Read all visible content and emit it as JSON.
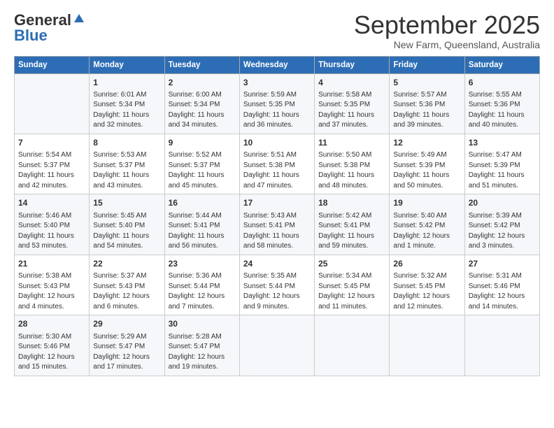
{
  "header": {
    "logo_general": "General",
    "logo_blue": "Blue",
    "month": "September 2025",
    "location": "New Farm, Queensland, Australia"
  },
  "days_of_week": [
    "Sunday",
    "Monday",
    "Tuesday",
    "Wednesday",
    "Thursday",
    "Friday",
    "Saturday"
  ],
  "weeks": [
    [
      {
        "day": "",
        "sunrise": "",
        "sunset": "",
        "daylight": ""
      },
      {
        "day": "1",
        "sunrise": "Sunrise: 6:01 AM",
        "sunset": "Sunset: 5:34 PM",
        "daylight": "Daylight: 11 hours and 32 minutes."
      },
      {
        "day": "2",
        "sunrise": "Sunrise: 6:00 AM",
        "sunset": "Sunset: 5:34 PM",
        "daylight": "Daylight: 11 hours and 34 minutes."
      },
      {
        "day": "3",
        "sunrise": "Sunrise: 5:59 AM",
        "sunset": "Sunset: 5:35 PM",
        "daylight": "Daylight: 11 hours and 36 minutes."
      },
      {
        "day": "4",
        "sunrise": "Sunrise: 5:58 AM",
        "sunset": "Sunset: 5:35 PM",
        "daylight": "Daylight: 11 hours and 37 minutes."
      },
      {
        "day": "5",
        "sunrise": "Sunrise: 5:57 AM",
        "sunset": "Sunset: 5:36 PM",
        "daylight": "Daylight: 11 hours and 39 minutes."
      },
      {
        "day": "6",
        "sunrise": "Sunrise: 5:55 AM",
        "sunset": "Sunset: 5:36 PM",
        "daylight": "Daylight: 11 hours and 40 minutes."
      }
    ],
    [
      {
        "day": "7",
        "sunrise": "Sunrise: 5:54 AM",
        "sunset": "Sunset: 5:37 PM",
        "daylight": "Daylight: 11 hours and 42 minutes."
      },
      {
        "day": "8",
        "sunrise": "Sunrise: 5:53 AM",
        "sunset": "Sunset: 5:37 PM",
        "daylight": "Daylight: 11 hours and 43 minutes."
      },
      {
        "day": "9",
        "sunrise": "Sunrise: 5:52 AM",
        "sunset": "Sunset: 5:37 PM",
        "daylight": "Daylight: 11 hours and 45 minutes."
      },
      {
        "day": "10",
        "sunrise": "Sunrise: 5:51 AM",
        "sunset": "Sunset: 5:38 PM",
        "daylight": "Daylight: 11 hours and 47 minutes."
      },
      {
        "day": "11",
        "sunrise": "Sunrise: 5:50 AM",
        "sunset": "Sunset: 5:38 PM",
        "daylight": "Daylight: 11 hours and 48 minutes."
      },
      {
        "day": "12",
        "sunrise": "Sunrise: 5:49 AM",
        "sunset": "Sunset: 5:39 PM",
        "daylight": "Daylight: 11 hours and 50 minutes."
      },
      {
        "day": "13",
        "sunrise": "Sunrise: 5:47 AM",
        "sunset": "Sunset: 5:39 PM",
        "daylight": "Daylight: 11 hours and 51 minutes."
      }
    ],
    [
      {
        "day": "14",
        "sunrise": "Sunrise: 5:46 AM",
        "sunset": "Sunset: 5:40 PM",
        "daylight": "Daylight: 11 hours and 53 minutes."
      },
      {
        "day": "15",
        "sunrise": "Sunrise: 5:45 AM",
        "sunset": "Sunset: 5:40 PM",
        "daylight": "Daylight: 11 hours and 54 minutes."
      },
      {
        "day": "16",
        "sunrise": "Sunrise: 5:44 AM",
        "sunset": "Sunset: 5:41 PM",
        "daylight": "Daylight: 11 hours and 56 minutes."
      },
      {
        "day": "17",
        "sunrise": "Sunrise: 5:43 AM",
        "sunset": "Sunset: 5:41 PM",
        "daylight": "Daylight: 11 hours and 58 minutes."
      },
      {
        "day": "18",
        "sunrise": "Sunrise: 5:42 AM",
        "sunset": "Sunset: 5:41 PM",
        "daylight": "Daylight: 11 hours and 59 minutes."
      },
      {
        "day": "19",
        "sunrise": "Sunrise: 5:40 AM",
        "sunset": "Sunset: 5:42 PM",
        "daylight": "Daylight: 12 hours and 1 minute."
      },
      {
        "day": "20",
        "sunrise": "Sunrise: 5:39 AM",
        "sunset": "Sunset: 5:42 PM",
        "daylight": "Daylight: 12 hours and 3 minutes."
      }
    ],
    [
      {
        "day": "21",
        "sunrise": "Sunrise: 5:38 AM",
        "sunset": "Sunset: 5:43 PM",
        "daylight": "Daylight: 12 hours and 4 minutes."
      },
      {
        "day": "22",
        "sunrise": "Sunrise: 5:37 AM",
        "sunset": "Sunset: 5:43 PM",
        "daylight": "Daylight: 12 hours and 6 minutes."
      },
      {
        "day": "23",
        "sunrise": "Sunrise: 5:36 AM",
        "sunset": "Sunset: 5:44 PM",
        "daylight": "Daylight: 12 hours and 7 minutes."
      },
      {
        "day": "24",
        "sunrise": "Sunrise: 5:35 AM",
        "sunset": "Sunset: 5:44 PM",
        "daylight": "Daylight: 12 hours and 9 minutes."
      },
      {
        "day": "25",
        "sunrise": "Sunrise: 5:34 AM",
        "sunset": "Sunset: 5:45 PM",
        "daylight": "Daylight: 12 hours and 11 minutes."
      },
      {
        "day": "26",
        "sunrise": "Sunrise: 5:32 AM",
        "sunset": "Sunset: 5:45 PM",
        "daylight": "Daylight: 12 hours and 12 minutes."
      },
      {
        "day": "27",
        "sunrise": "Sunrise: 5:31 AM",
        "sunset": "Sunset: 5:46 PM",
        "daylight": "Daylight: 12 hours and 14 minutes."
      }
    ],
    [
      {
        "day": "28",
        "sunrise": "Sunrise: 5:30 AM",
        "sunset": "Sunset: 5:46 PM",
        "daylight": "Daylight: 12 hours and 15 minutes."
      },
      {
        "day": "29",
        "sunrise": "Sunrise: 5:29 AM",
        "sunset": "Sunset: 5:47 PM",
        "daylight": "Daylight: 12 hours and 17 minutes."
      },
      {
        "day": "30",
        "sunrise": "Sunrise: 5:28 AM",
        "sunset": "Sunset: 5:47 PM",
        "daylight": "Daylight: 12 hours and 19 minutes."
      },
      {
        "day": "",
        "sunrise": "",
        "sunset": "",
        "daylight": ""
      },
      {
        "day": "",
        "sunrise": "",
        "sunset": "",
        "daylight": ""
      },
      {
        "day": "",
        "sunrise": "",
        "sunset": "",
        "daylight": ""
      },
      {
        "day": "",
        "sunrise": "",
        "sunset": "",
        "daylight": ""
      }
    ]
  ]
}
